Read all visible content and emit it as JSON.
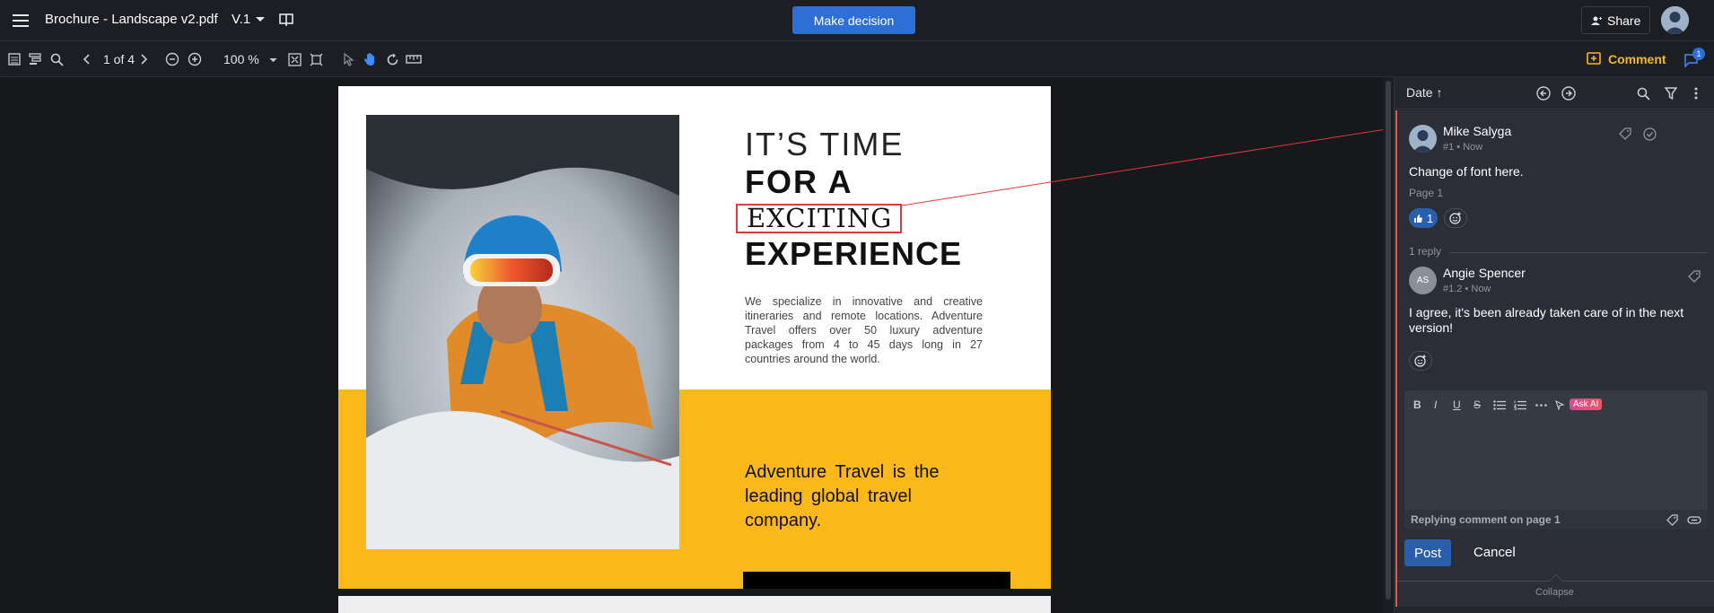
{
  "header": {
    "file_title": "Brochure - Landscape v2.pdf",
    "version": "V.1",
    "decision_label": "Make decision",
    "share_label": "Share"
  },
  "toolbar": {
    "page_indicator": "1 of 4",
    "zoom": "100 %",
    "comment_label": "Comment",
    "notification_count": "1"
  },
  "document": {
    "headline_line1": "IT’S TIME",
    "headline_line2": "FOR A",
    "headline_line3": "EXCITING",
    "headline_line4": "EXPERIENCE",
    "paragraph": "We specialize in innovative and creative itineraries and remote locations. Adventure Travel offers over 50 luxury adventure packages from 4 to 45 days long in 27 countries around the world.",
    "tagline": "Adventure Travel is the leading global travel company."
  },
  "comments_panel": {
    "sort_label": "Date ↑",
    "comment": {
      "author": "Mike Salyga",
      "meta": "#1 • Now",
      "text": "Change of font here.",
      "page": "Page 1",
      "like_count": "1",
      "replies_label": "1 reply"
    },
    "reply": {
      "author": "Angie Spencer",
      "initials": "AS",
      "meta": "#1.2 • Now",
      "text": "I agree, it's been already taken care of in the next version!"
    },
    "editor": {
      "ask_ai_label": "Ask AI",
      "footer_label": "Replying comment on page 1"
    },
    "post_label": "Post",
    "cancel_label": "Cancel",
    "collapse_label": "Collapse"
  },
  "colors": {
    "accent_blue": "#2d6fd6",
    "comment_yellow": "#f5b928",
    "highlight_red": "#e03a3a",
    "brochure_yellow": "#fbb81b"
  }
}
